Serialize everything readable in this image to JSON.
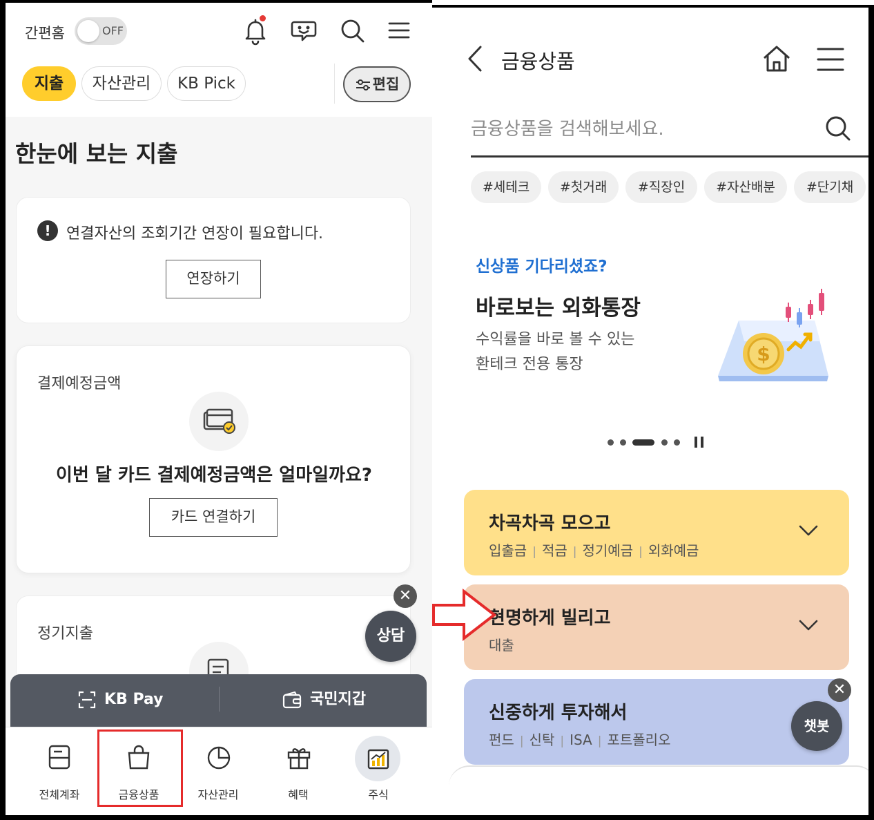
{
  "left": {
    "header": {
      "simple_home_label": "간편홈",
      "toggle_state": "OFF"
    },
    "tabs": [
      {
        "label": "지출",
        "active": true
      },
      {
        "label": "자산관리",
        "active": false
      },
      {
        "label": "KB Pick",
        "active": false
      }
    ],
    "edit_label": "편집",
    "section_title": "한눈에 보는 지출",
    "notice": {
      "text": "연결자산의 조회기간 연장이 필요합니다.",
      "button": "연장하기"
    },
    "payment_card": {
      "label": "결제예정금액",
      "question": "이번 달 카드 결제예정금액은 얼마일까요?",
      "button": "카드 연결하기"
    },
    "regular_card": {
      "label": "정기지출"
    },
    "consult_label": "상담",
    "pay_bar": {
      "kbpay": "KB Pay",
      "wallet": "국민지갑"
    },
    "bottom_nav": [
      {
        "label": "전체계좌",
        "icon": "account-icon"
      },
      {
        "label": "금융상품",
        "icon": "bag-icon"
      },
      {
        "label": "자산관리",
        "icon": "pie-icon"
      },
      {
        "label": "혜택",
        "icon": "gift-icon"
      },
      {
        "label": "주식",
        "icon": "stock-chart-icon"
      }
    ],
    "highlight_color": "#e52b2b",
    "accent_color": "#ffcd2c"
  },
  "right": {
    "title": "금융상품",
    "search_placeholder": "금융상품을 검색해보세요.",
    "chips": [
      "#세테크",
      "#첫거래",
      "#직장인",
      "#자산배분",
      "#단기채"
    ],
    "promo": {
      "subtitle": "신상품 기다리셨죠?",
      "title": "바로보는 외화통장",
      "desc_line1": "수익률을 바로 볼 수 있는",
      "desc_line2": "환테크 전용 통장"
    },
    "carousel": {
      "total": 5,
      "active_index": 2
    },
    "accordions": [
      {
        "title": "차곡차곡 모으고",
        "subs": [
          "입출금",
          "적금",
          "정기예금",
          "외화예금"
        ],
        "color": "#ffe08a"
      },
      {
        "title": "현명하게 빌리고",
        "subs": [
          "대출"
        ],
        "color": "#f4d1b6"
      },
      {
        "title": "신중하게 투자해서",
        "subs": [
          "펀드",
          "신탁",
          "ISA",
          "포트폴리오"
        ],
        "color": "#bcc8ec"
      }
    ],
    "chatbot_label": "챗봇"
  }
}
